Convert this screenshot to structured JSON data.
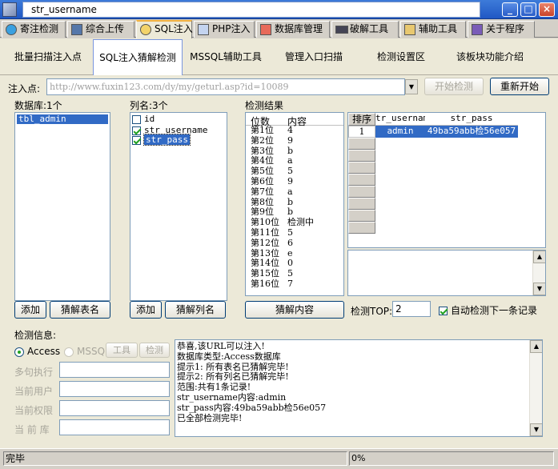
{
  "window": {
    "title": "str_username",
    "minimize": "_",
    "maximize": "□",
    "close": "×"
  },
  "tabs_main": [
    {
      "label": "寄注检测",
      "icon": "globe-icon"
    },
    {
      "label": "综合上传",
      "icon": "chart-icon"
    },
    {
      "label": "SQL注入",
      "icon": "magnifier-icon"
    },
    {
      "label": "PHP注入",
      "icon": "php-file-icon"
    },
    {
      "label": "数据库管理",
      "icon": "database-icon"
    },
    {
      "label": "破解工具",
      "icon": "keyboard-icon"
    },
    {
      "label": "辅助工具",
      "icon": "clipboard-icon"
    },
    {
      "label": "关于程序",
      "icon": "book-icon"
    }
  ],
  "tabs_sub": [
    "批量扫描注入点",
    "SQL注入猜解检测",
    "MSSQL辅助工具",
    "管理入口扫描",
    "检测设置区",
    "该板块功能介绍"
  ],
  "inject": {
    "label": "注入点:",
    "url": "http://www.fuxin123.com/dy/my/geturl.asp?id=10089",
    "start_btn": "开始检测",
    "restart_btn": "重新开始"
  },
  "database": {
    "label": "数据库:1个",
    "items": [
      "tbl_admin"
    ],
    "add_btn": "添加",
    "guess_btn": "猜解表名"
  },
  "columns": {
    "label": "列名:3个",
    "items": [
      {
        "name": "id",
        "checked": false
      },
      {
        "name": "str_username",
        "checked": true
      },
      {
        "name": "str_pass",
        "checked": true
      }
    ],
    "add_btn": "添加",
    "guess_btn": "猜解列名"
  },
  "results": {
    "label": "检测结果",
    "headers": [
      "位数",
      "内容"
    ],
    "rows": [
      [
        "第1位",
        "4"
      ],
      [
        "第2位",
        "9"
      ],
      [
        "第3位",
        "b"
      ],
      [
        "第4位",
        "a"
      ],
      [
        "第5位",
        "5"
      ],
      [
        "第6位",
        "9"
      ],
      [
        "第7位",
        "a"
      ],
      [
        "第8位",
        "b"
      ],
      [
        "第9位",
        "b"
      ],
      [
        "第10位",
        "检测中"
      ],
      [
        "第11位",
        "5"
      ],
      [
        "第12位",
        "6"
      ],
      [
        "第13位",
        "e"
      ],
      [
        "第14位",
        "0"
      ],
      [
        "第15位",
        "5"
      ],
      [
        "第16位",
        "7"
      ]
    ],
    "guess_btn": "猜解内容"
  },
  "grid": {
    "headers": [
      "排序",
      "tr_usernam",
      "str_pass"
    ],
    "rows": [
      [
        "1",
        "admin",
        "49ba59abb检56e057"
      ]
    ]
  },
  "top": {
    "label": "检测TOP:",
    "value": "2",
    "auto_label": "自动检测下一条记录"
  },
  "info": {
    "label": "检测信息:",
    "radio_access": "Access",
    "radio_mssql": "MSSQL",
    "btn1": "工具",
    "btn2": "检测",
    "fields": [
      "多句执行",
      "当前用户",
      "当前权限",
      "当 前 库"
    ]
  },
  "log": [
    "恭喜,该URL可以注入!",
    "数据库类型:Access数据库",
    "提示1: 所有表名已猜解完毕!",
    "提示2: 所有列名已猜解完毕!",
    "范围:共有1条记录!",
    "str_username内容:admin",
    "str_pass内容:49ba59abb检56e057",
    "已全部检测完毕!"
  ],
  "status": {
    "left": "完毕",
    "progress": "0%"
  }
}
